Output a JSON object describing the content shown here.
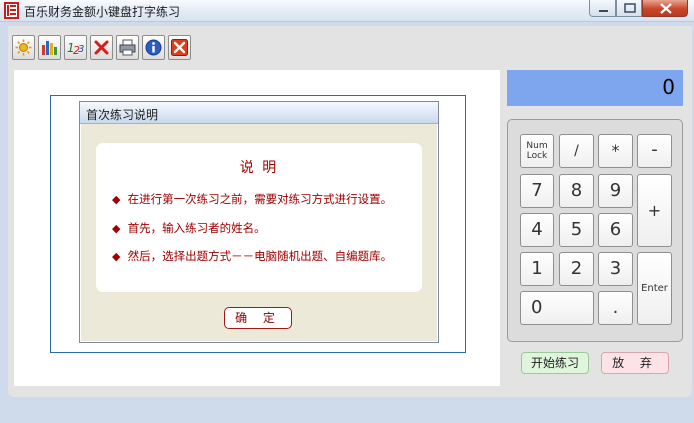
{
  "window": {
    "title": "百乐财务金额小键盘打字练习"
  },
  "toolbar": {
    "buttons": [
      {
        "icon": "settings-sun-icon"
      },
      {
        "icon": "stats-chart-icon"
      },
      {
        "icon": "edit-icon"
      },
      {
        "icon": "delete-icon"
      },
      {
        "icon": "print-icon"
      },
      {
        "icon": "info-icon"
      },
      {
        "icon": "exit-icon"
      }
    ]
  },
  "dialog": {
    "title": "首次练习说明",
    "heading": "说  明",
    "items": [
      "在进行第一次练习之前，需要对练习方式进行设置。",
      "首先，输入练习者的姓名。",
      "然后，选择出题方式－－电脑随机出题、自编题库。"
    ],
    "ok_label": "确  定"
  },
  "display": {
    "value": "0"
  },
  "keypad": {
    "numlock_line1": "Num",
    "numlock_line2": "Lock",
    "divide": "/",
    "multiply": "*",
    "minus": "-",
    "k7": "7",
    "k8": "8",
    "k9": "9",
    "plus": "+",
    "k4": "4",
    "k5": "5",
    "k6": "6",
    "k1": "1",
    "k2": "2",
    "k3": "3",
    "enter": "Enter",
    "k0": "0",
    "dot": "."
  },
  "actions": {
    "start_label": "开始练习",
    "abandon_label": "放  弃"
  },
  "colors": {
    "display_bg": "#7ea6ee",
    "dialog_text": "#a00000",
    "start_bg": "#dff5dc",
    "abandon_bg": "#fbe3e6"
  }
}
